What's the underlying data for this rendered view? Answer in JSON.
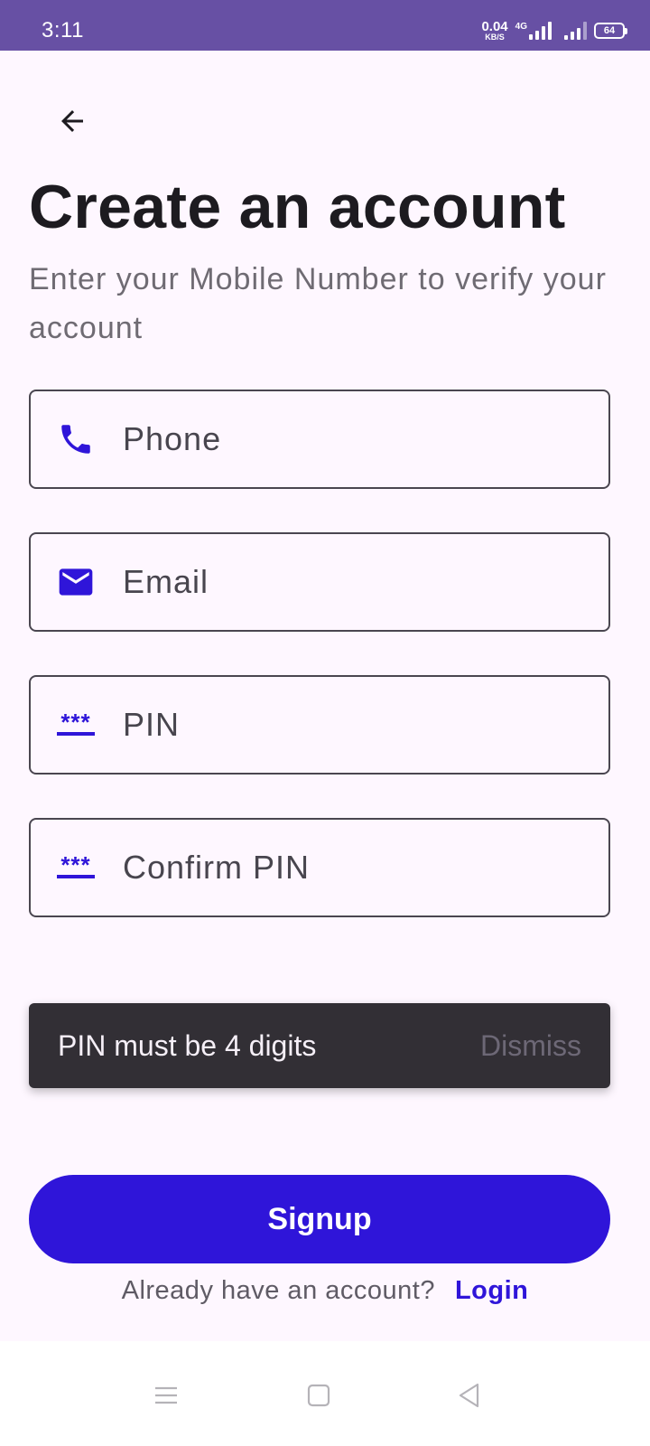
{
  "status_bar": {
    "time": "3:11",
    "net_speed_value": "0.04",
    "net_speed_unit": "KB/S",
    "network_type": "4G",
    "battery_level": "64",
    "background": "#6750a4"
  },
  "header": {
    "back_icon": "arrow-left-icon",
    "title": "Create an account",
    "subtitle": "Enter your Mobile Number to verify your account"
  },
  "form": {
    "fields": [
      {
        "icon": "phone-icon",
        "placeholder": "Phone",
        "value": ""
      },
      {
        "icon": "mail-icon",
        "placeholder": "Email",
        "value": ""
      },
      {
        "icon": "pin-icon",
        "placeholder": "PIN",
        "value": ""
      },
      {
        "icon": "pin-icon",
        "placeholder": "Confirm PIN",
        "value": ""
      }
    ],
    "pin_icon_glyph": "***"
  },
  "snackbar": {
    "message": "PIN must be 4 digits",
    "action": "Dismiss"
  },
  "actions": {
    "signup_label": "Signup",
    "login_prompt": "Already have an account?",
    "login_label": "Login"
  },
  "nav_bar": {
    "buttons": [
      "menu-icon",
      "home-square-icon",
      "back-triangle-icon"
    ]
  },
  "colors": {
    "accent": "#2f15d9",
    "background": "#fef7ff",
    "snackbar": "#322f35"
  }
}
